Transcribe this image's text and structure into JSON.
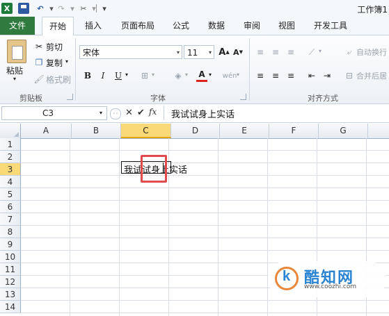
{
  "qat": {
    "app_icon_letter": "X",
    "window_title": "工作簿1"
  },
  "tabs": [
    "文件",
    "开始",
    "插入",
    "页面布局",
    "公式",
    "数据",
    "审阅",
    "视图",
    "开发工具"
  ],
  "ribbon": {
    "clipboard": {
      "paste": "粘贴",
      "cut": "剪切",
      "copy": "复制",
      "format_painter": "格式刷",
      "label": "剪贴板"
    },
    "font": {
      "name": "宋体",
      "size": "11",
      "bold": "B",
      "italic": "I",
      "underline": "U",
      "label": "字体"
    },
    "align": {
      "wrap": "自动换行",
      "merge": "合并后居",
      "label": "对齐方式"
    }
  },
  "formula_bar": {
    "name_box": "C3",
    "fx": "fx",
    "content": "我试试身上实话"
  },
  "grid": {
    "columns": [
      "A",
      "B",
      "C",
      "D",
      "E",
      "F",
      "G"
    ],
    "selected_column": "C",
    "rows": [
      "1",
      "2",
      "3",
      "4",
      "5",
      "6",
      "7",
      "8",
      "9",
      "10",
      "11",
      "12",
      "13",
      "14"
    ],
    "selected_row": "3",
    "cell_c3": "我试试身上实话"
  },
  "watermark": {
    "brand": "酷知网",
    "url": "www.coozhi.com"
  },
  "colors": {
    "file_tab": "#2f7b3e",
    "selection": "#f9d978",
    "highlight_box": "#e14b4b"
  }
}
